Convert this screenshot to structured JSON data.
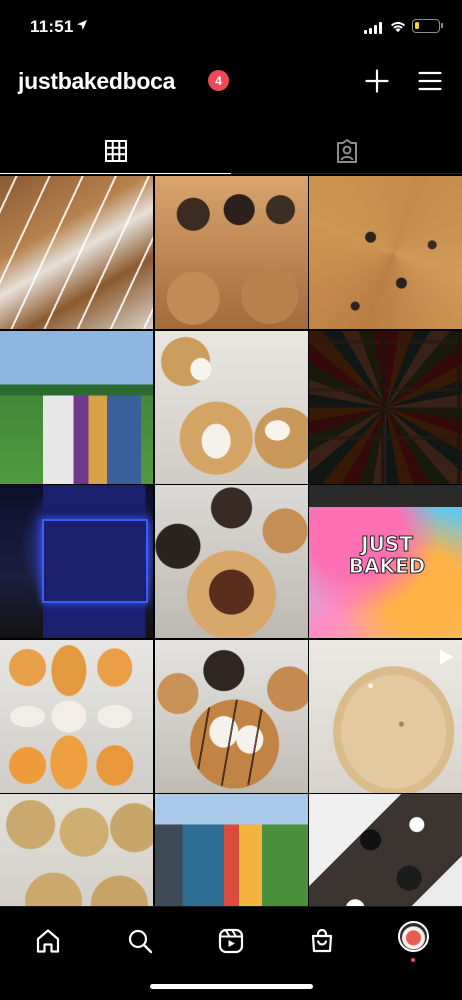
{
  "status_bar": {
    "time": "11:51",
    "icons": [
      "location-arrow-icon",
      "cellular-signal-icon",
      "wifi-icon",
      "battery-icon"
    ],
    "battery_level": 0.2,
    "battery_color": "#f4d23c"
  },
  "header": {
    "username": "justbakedboca",
    "notification_count": "4",
    "badge_color": "#ed4956",
    "actions": [
      "new-post-icon",
      "menu-icon"
    ]
  },
  "tabs": [
    {
      "icon": "grid-icon",
      "active": true
    },
    {
      "icon": "tagged-icon",
      "active": false
    }
  ],
  "posts": [
    {
      "subject": "iced scones",
      "type": "photo"
    },
    {
      "subject": "cookie cupcakes",
      "type": "photo"
    },
    {
      "subject": "cookie pizza slices",
      "type": "photo"
    },
    {
      "subject": "food trucks in park",
      "type": "photo"
    },
    {
      "subject": "marshmallow cookies",
      "type": "photo"
    },
    {
      "subject": "sprinkle brownies",
      "type": "photo"
    },
    {
      "subject": "lit food truck at night",
      "type": "photo"
    },
    {
      "subject": "stuffed cookies",
      "type": "photo"
    },
    {
      "subject": "tie-dye shirt",
      "type": "photo",
      "print": "JUST BAKED"
    },
    {
      "subject": "halloween cookies",
      "type": "photo"
    },
    {
      "subject": "smores cookies",
      "type": "photo"
    },
    {
      "subject": "sugar cookie",
      "type": "reel"
    },
    {
      "subject": "chocolate chip cookies",
      "type": "photo"
    },
    {
      "subject": "food truck mural",
      "type": "photo"
    },
    {
      "subject": "cookies and cream bars",
      "type": "photo"
    }
  ],
  "bottom_nav": [
    {
      "icon": "home-icon"
    },
    {
      "icon": "search-icon"
    },
    {
      "icon": "reels-icon"
    },
    {
      "icon": "shop-icon"
    },
    {
      "icon": "profile-avatar"
    }
  ],
  "colors": {
    "background": "#000000",
    "foreground": "#ffffff",
    "activity_dot": "#ed4956"
  }
}
